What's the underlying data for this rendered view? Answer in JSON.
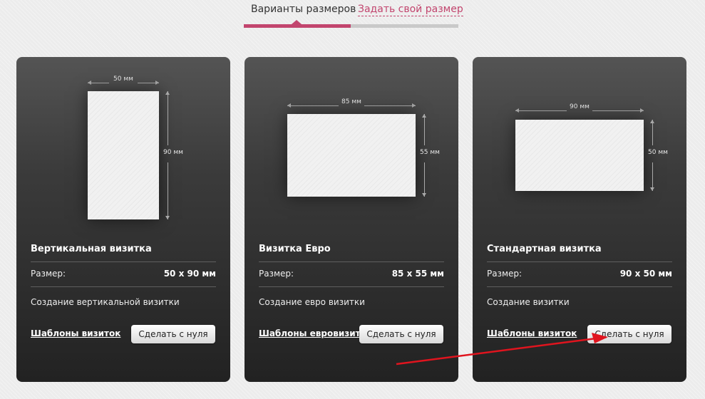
{
  "tabs": {
    "active_label": "Варианты размеров",
    "custom_label": "Задать свой размер"
  },
  "colors": {
    "accent": "#c2456e",
    "card_top": "#545454",
    "card_bottom": "#222222",
    "annotation": "#e0141e"
  },
  "cards": [
    {
      "width_label": "50 мм",
      "height_label": "90 мм",
      "title": "Вертикальная визитка",
      "size_label": "Размер:",
      "size_value": "50 х 90 мм",
      "create_text": "Создание вертикальной визитки",
      "templates_link": "Шаблоны визиток",
      "button_label": "Сделать с нуля"
    },
    {
      "width_label": "85 мм",
      "height_label": "55 мм",
      "title": "Визитка Евро",
      "size_label": "Размер:",
      "size_value": "85 х 55 мм",
      "create_text": "Создание евро визитки",
      "templates_link": "Шаблоны евровизиток",
      "button_label": "Сделать с нуля"
    },
    {
      "width_label": "90 мм",
      "height_label": "50 мм",
      "title": "Стандартная визитка",
      "size_label": "Размер:",
      "size_value": "90 х 50 мм",
      "create_text": "Создание визитки",
      "templates_link": "Шаблоны визиток",
      "button_label": "Сделать с нуля"
    }
  ]
}
